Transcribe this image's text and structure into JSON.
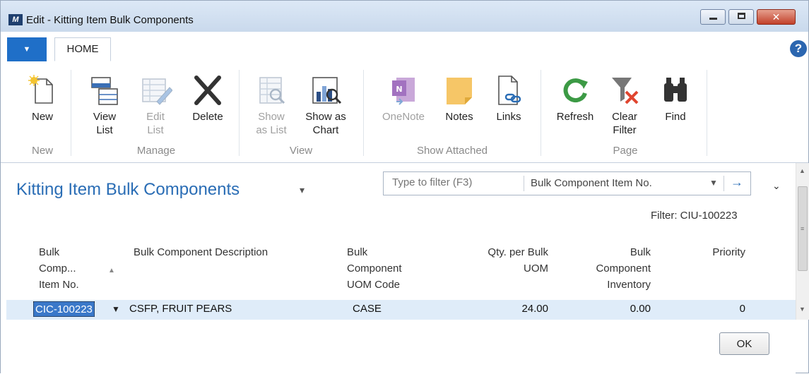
{
  "window": {
    "title": "Edit - Kitting Item Bulk Components"
  },
  "ribbon": {
    "tab": "HOME",
    "buttons": {
      "new": "New",
      "view_list": [
        "View",
        "List"
      ],
      "edit_list": [
        "Edit",
        "List"
      ],
      "delete": "Delete",
      "show_as_list": [
        "Show",
        "as List"
      ],
      "show_as_chart": [
        "Show as",
        "Chart"
      ],
      "onenote": "OneNote",
      "notes": "Notes",
      "links": "Links",
      "refresh": "Refresh",
      "clear_filter": [
        "Clear",
        "Filter"
      ],
      "find": "Find"
    },
    "groups": {
      "new": "New",
      "manage": "Manage",
      "view": "View",
      "show_attached": "Show Attached",
      "page": "Page"
    }
  },
  "page": {
    "title": "Kitting Item Bulk Components",
    "filter": {
      "placeholder": "Type to filter (F3)",
      "field": "Bulk Component Item No."
    },
    "filter_status": "Filter: CIU-100223"
  },
  "table": {
    "headers": {
      "item_no": [
        "Bulk",
        "Comp...",
        "Item No."
      ],
      "description": [
        "Bulk Component Description"
      ],
      "uom_code": [
        "Bulk",
        "Component",
        "UOM Code"
      ],
      "qty": [
        "Qty. per Bulk",
        "UOM"
      ],
      "inventory": [
        "Bulk",
        "Component",
        "Inventory"
      ],
      "priority": [
        "Priority"
      ]
    },
    "rows": [
      {
        "item_no": "CIC-100223",
        "description": "CSFP,  FRUIT PEARS",
        "uom_code": "CASE",
        "qty": "24.00",
        "inventory": "0.00",
        "priority": "0"
      }
    ]
  },
  "actions": {
    "ok": "OK"
  },
  "colors": {
    "accent": "#2a6db5",
    "selection": "#3a78c9",
    "row_bg": "#dfecf9"
  }
}
